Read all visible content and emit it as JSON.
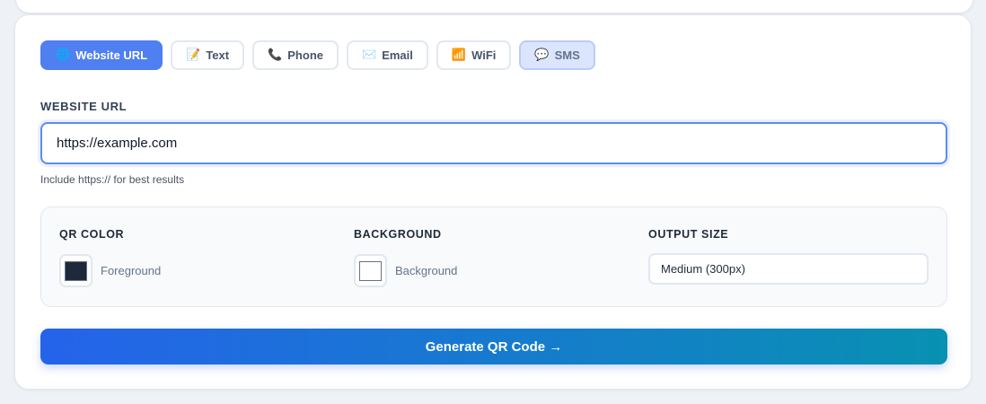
{
  "tabs": [
    {
      "icon": "🌐",
      "icon_name": "globe-icon",
      "label": "Website URL",
      "state": "active"
    },
    {
      "icon": "📝",
      "icon_name": "memo-icon",
      "label": "Text",
      "state": "normal"
    },
    {
      "icon": "📞",
      "icon_name": "phone-icon",
      "label": "Phone",
      "state": "normal"
    },
    {
      "icon": "✉️",
      "icon_name": "envelope-icon",
      "label": "Email",
      "state": "normal"
    },
    {
      "icon": "📶",
      "icon_name": "wifi-signal-icon",
      "label": "WiFi",
      "state": "normal"
    },
    {
      "icon": "💬",
      "icon_name": "speech-bubble-icon",
      "label": "SMS",
      "state": "hover"
    }
  ],
  "url_field": {
    "label": "WEBSITE URL",
    "value": "https://example.com",
    "hint": "Include https:// for best results"
  },
  "options": {
    "qr_color": {
      "label": "QR COLOR",
      "swatch_label": "Foreground",
      "color": "#1e293b"
    },
    "background": {
      "label": "BACKGROUND",
      "swatch_label": "Background",
      "color": "#ffffff"
    },
    "output_size": {
      "label": "OUTPUT SIZE",
      "selected": "Medium (300px)"
    }
  },
  "generate_button": {
    "label": "Generate QR Code →"
  },
  "colors": {
    "accent": "#4f7ff0",
    "gradient_start": "#2563eb",
    "gradient_end": "#0891b2"
  }
}
